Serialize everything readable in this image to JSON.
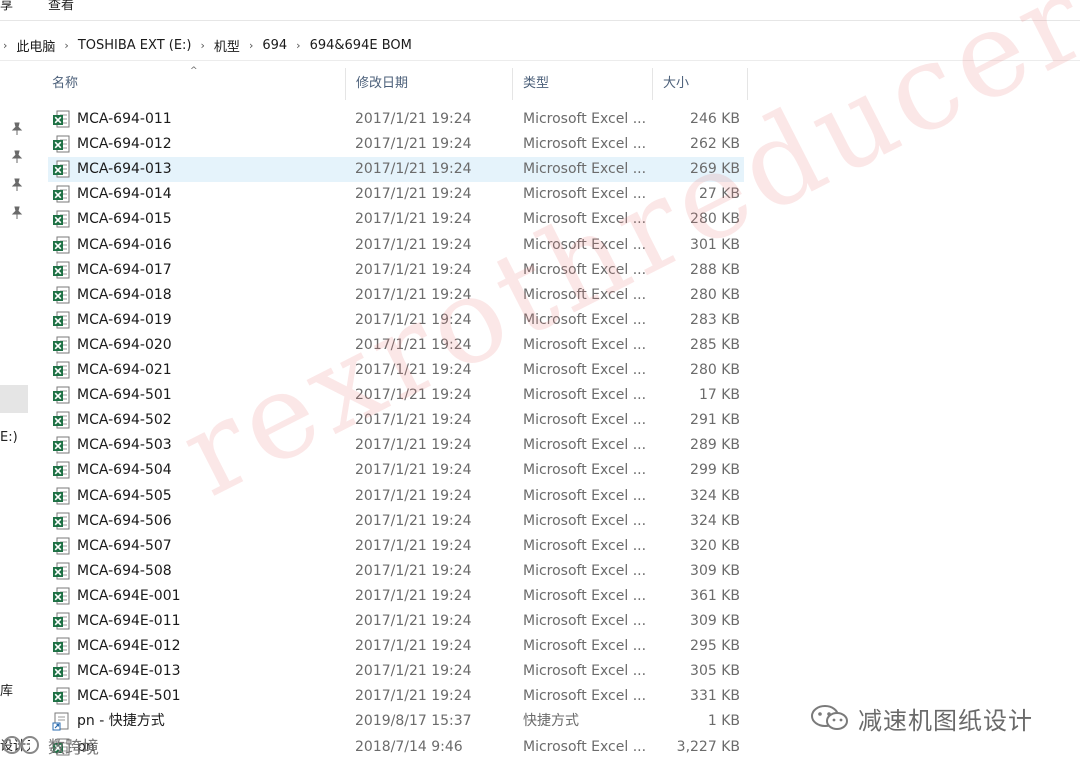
{
  "ribbon": {
    "tabs": [
      "享",
      "查看"
    ]
  },
  "breadcrumb": [
    "此电脑",
    "TOSHIBA EXT (E:)",
    "机型",
    "694",
    "694&694E  BOM"
  ],
  "nav_fragments": {
    "drive": "E:)",
    "item_a": "库",
    "item_b": "设计元"
  },
  "columns": {
    "name": "名称",
    "date": "修改日期",
    "type": "类型",
    "size": "大小"
  },
  "files": [
    {
      "name": "MCA-694-011",
      "date": "2017/1/21 19:24",
      "type": "Microsoft Excel ...",
      "size": "246 KB",
      "icon": "excel-icon"
    },
    {
      "name": "MCA-694-012",
      "date": "2017/1/21 19:24",
      "type": "Microsoft Excel ...",
      "size": "262 KB",
      "icon": "excel-icon"
    },
    {
      "name": "MCA-694-013",
      "date": "2017/1/21 19:24",
      "type": "Microsoft Excel ...",
      "size": "269 KB",
      "icon": "excel-icon",
      "selected": true
    },
    {
      "name": "MCA-694-014",
      "date": "2017/1/21 19:24",
      "type": "Microsoft Excel ...",
      "size": "27 KB",
      "icon": "excel-icon"
    },
    {
      "name": "MCA-694-015",
      "date": "2017/1/21 19:24",
      "type": "Microsoft Excel ...",
      "size": "280 KB",
      "icon": "excel-icon"
    },
    {
      "name": "MCA-694-016",
      "date": "2017/1/21 19:24",
      "type": "Microsoft Excel ...",
      "size": "301 KB",
      "icon": "excel-icon"
    },
    {
      "name": "MCA-694-017",
      "date": "2017/1/21 19:24",
      "type": "Microsoft Excel ...",
      "size": "288 KB",
      "icon": "excel-icon"
    },
    {
      "name": "MCA-694-018",
      "date": "2017/1/21 19:24",
      "type": "Microsoft Excel ...",
      "size": "280 KB",
      "icon": "excel-icon"
    },
    {
      "name": "MCA-694-019",
      "date": "2017/1/21 19:24",
      "type": "Microsoft Excel ...",
      "size": "283 KB",
      "icon": "excel-icon"
    },
    {
      "name": "MCA-694-020",
      "date": "2017/1/21 19:24",
      "type": "Microsoft Excel ...",
      "size": "285 KB",
      "icon": "excel-icon"
    },
    {
      "name": "MCA-694-021",
      "date": "2017/1/21 19:24",
      "type": "Microsoft Excel ...",
      "size": "280 KB",
      "icon": "excel-icon"
    },
    {
      "name": "MCA-694-501",
      "date": "2017/1/21 19:24",
      "type": "Microsoft Excel ...",
      "size": "17 KB",
      "icon": "excel-icon"
    },
    {
      "name": "MCA-694-502",
      "date": "2017/1/21 19:24",
      "type": "Microsoft Excel ...",
      "size": "291 KB",
      "icon": "excel-icon"
    },
    {
      "name": "MCA-694-503",
      "date": "2017/1/21 19:24",
      "type": "Microsoft Excel ...",
      "size": "289 KB",
      "icon": "excel-icon"
    },
    {
      "name": "MCA-694-504",
      "date": "2017/1/21 19:24",
      "type": "Microsoft Excel ...",
      "size": "299 KB",
      "icon": "excel-icon"
    },
    {
      "name": "MCA-694-505",
      "date": "2017/1/21 19:24",
      "type": "Microsoft Excel ...",
      "size": "324 KB",
      "icon": "excel-icon"
    },
    {
      "name": "MCA-694-506",
      "date": "2017/1/21 19:24",
      "type": "Microsoft Excel ...",
      "size": "324 KB",
      "icon": "excel-icon"
    },
    {
      "name": "MCA-694-507",
      "date": "2017/1/21 19:24",
      "type": "Microsoft Excel ...",
      "size": "320 KB",
      "icon": "excel-icon"
    },
    {
      "name": "MCA-694-508",
      "date": "2017/1/21 19:24",
      "type": "Microsoft Excel ...",
      "size": "309 KB",
      "icon": "excel-icon"
    },
    {
      "name": "MCA-694E-001",
      "date": "2017/1/21 19:24",
      "type": "Microsoft Excel ...",
      "size": "361 KB",
      "icon": "excel-icon"
    },
    {
      "name": "MCA-694E-011",
      "date": "2017/1/21 19:24",
      "type": "Microsoft Excel ...",
      "size": "309 KB",
      "icon": "excel-icon"
    },
    {
      "name": "MCA-694E-012",
      "date": "2017/1/21 19:24",
      "type": "Microsoft Excel ...",
      "size": "295 KB",
      "icon": "excel-icon"
    },
    {
      "name": "MCA-694E-013",
      "date": "2017/1/21 19:24",
      "type": "Microsoft Excel ...",
      "size": "305 KB",
      "icon": "excel-icon"
    },
    {
      "name": "MCA-694E-501",
      "date": "2017/1/21 19:24",
      "type": "Microsoft Excel ...",
      "size": "331 KB",
      "icon": "excel-icon"
    },
    {
      "name": "pn - 快捷方式",
      "date": "2019/8/17 15:37",
      "type": "快捷方式",
      "size": "1 KB",
      "icon": "shortcut-icon"
    },
    {
      "name": "pn",
      "date": "2018/7/14 9:46",
      "type": "Microsoft Excel ...",
      "size": "3,227 KB",
      "icon": "excel-icon"
    }
  ],
  "watermark": "rexrothreducer",
  "wechat_label": "减速机图纸设计",
  "corner_badge": "数跨境",
  "colors": {
    "selected_row": "#e5f3fb",
    "header_text": "#4c607a",
    "excel_green": "#1e7145",
    "watermark": "#eb7878"
  }
}
